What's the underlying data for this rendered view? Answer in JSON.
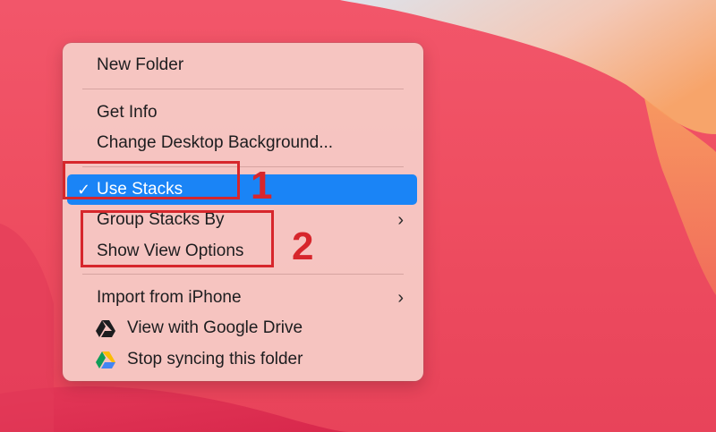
{
  "menu": {
    "items": [
      {
        "label": "New Folder"
      },
      {
        "label": "Get Info"
      },
      {
        "label": "Change Desktop Background..."
      },
      {
        "label": "Use Stacks",
        "checked": true,
        "selected": true,
        "check_mark": "✓"
      },
      {
        "label": "Group Stacks By",
        "submenu": true,
        "chevron": "›"
      },
      {
        "label": "Show View Options"
      },
      {
        "label": "Import from iPhone",
        "submenu": true,
        "chevron": "›"
      },
      {
        "label": "View with Google Drive",
        "icon": "google-drive-mono-icon"
      },
      {
        "label": "Stop syncing this folder",
        "icon": "google-drive-color-icon"
      }
    ]
  },
  "annotations": [
    {
      "number": "1",
      "color": "#d7262c"
    },
    {
      "number": "2",
      "color": "#d7262c"
    }
  ],
  "colors": {
    "highlight": "#1a84f6",
    "wallpaper_red": "#ee4d60",
    "wallpaper_orange": "#f8a25a",
    "annotation_red": "#d7262c"
  }
}
